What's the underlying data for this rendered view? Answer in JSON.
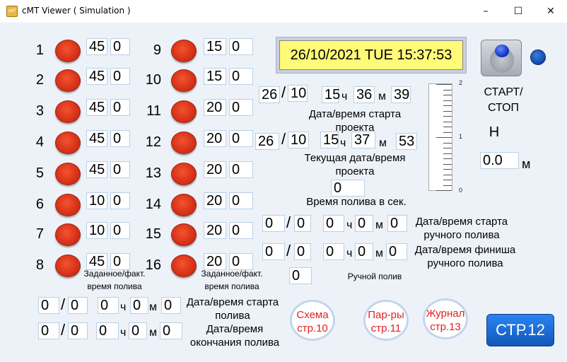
{
  "window": {
    "title": "cMT Viewer ( Simulation )",
    "icon": "cmt-app-icon",
    "minimize": "–",
    "maximize": "☐",
    "close": "✕"
  },
  "datetime_display": "26/10/2021 TUE 15:37:53",
  "channels_left": [
    {
      "id": "1",
      "set": "45",
      "act": "0"
    },
    {
      "id": "2",
      "set": "45",
      "act": "0"
    },
    {
      "id": "3",
      "set": "45",
      "act": "0"
    },
    {
      "id": "4",
      "set": "45",
      "act": "0"
    },
    {
      "id": "5",
      "set": "45",
      "act": "0"
    },
    {
      "id": "6",
      "set": "10",
      "act": "0"
    },
    {
      "id": "7",
      "set": "10",
      "act": "0"
    },
    {
      "id": "8",
      "set": "45",
      "act": "0"
    }
  ],
  "channels_right": [
    {
      "id": "9",
      "set": "15",
      "act": "0"
    },
    {
      "id": "10",
      "set": "15",
      "act": "0"
    },
    {
      "id": "11",
      "set": "20",
      "act": "0"
    },
    {
      "id": "12",
      "set": "20",
      "act": "0"
    },
    {
      "id": "13",
      "set": "20",
      "act": "0"
    },
    {
      "id": "14",
      "set": "20",
      "act": "0"
    },
    {
      "id": "15",
      "set": "20",
      "act": "0"
    },
    {
      "id": "16",
      "set": "20",
      "act": "0"
    }
  ],
  "labels": {
    "set_actual_left": "Заданное/факт.\nвремя полива",
    "set_actual_right": "Заданное/факт.\nвремя полива",
    "project_start": "Дата/время старта\nпроекта",
    "current_datetime": "Текущая дата/время\nпроекта",
    "watering_seconds": "Время полива в сек.",
    "manual_start": "Дата/время старта\nручного полива",
    "manual_finish": "Дата/время финиша\nручного полива",
    "manual_watering": "Ручной полив",
    "watering_start": "Дата/время старта\nполива",
    "watering_end": "Дата/время\nокончания полива",
    "start_stop": "СТАРТ/\nСТОП",
    "h_label": "H",
    "m_unit": "м"
  },
  "units": {
    "hour": "ч",
    "minute": "м"
  },
  "project_start": {
    "day": "26",
    "month": "10",
    "hour": "15",
    "minute": "36",
    "second": "39"
  },
  "current": {
    "day": "26",
    "month": "10",
    "hour": "15",
    "minute": "37",
    "second": "53"
  },
  "watering_seconds_value": "0",
  "manual_start": {
    "day": "0",
    "month": "0",
    "hour": "0",
    "minute": "0",
    "second": "0"
  },
  "manual_finish": {
    "day": "0",
    "month": "0",
    "hour": "0",
    "minute": "0",
    "second": "0"
  },
  "manual_watering_value": "0",
  "watering_start": {
    "day": "0",
    "month": "0",
    "hour": "0",
    "minute": "0",
    "second": "0"
  },
  "watering_end": {
    "day": "0",
    "month": "0",
    "hour": "0",
    "minute": "0",
    "second": "0"
  },
  "level": {
    "value": "0.0",
    "scale_max": "2",
    "scale_mid": "1",
    "scale_min": "0"
  },
  "nav": {
    "scheme": "Схема\nстр.10",
    "params": "Пар-ры\nстр.11",
    "journal": "Журнал\nстр.13",
    "page": "СТР.12"
  },
  "colors": {
    "lamp": "#d9331a",
    "datetime_bg": "#fffa77",
    "nav_text": "#e32020",
    "page_btn": "#1a6fd8",
    "led": "#1650b5"
  }
}
